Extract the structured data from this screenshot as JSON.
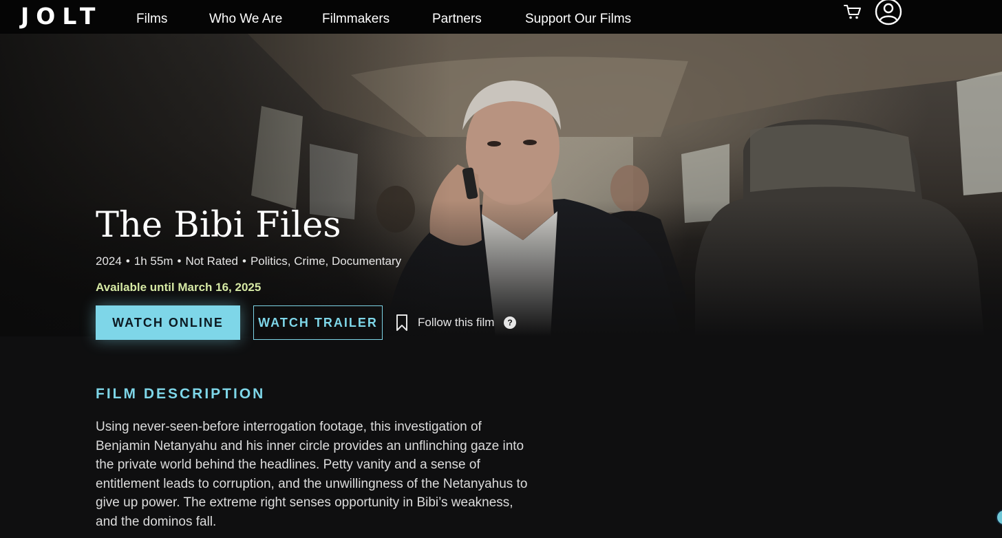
{
  "brand": {
    "logo": "JOLT"
  },
  "nav": {
    "links": [
      "Films",
      "Who We Are",
      "Filmmakers",
      "Partners",
      "Support Our Films"
    ],
    "cart_icon": "cart-icon",
    "account_icon": "user-icon"
  },
  "film": {
    "title": "The Bibi Files",
    "year": "2024",
    "runtime": "1h 55m",
    "rating": "Not Rated",
    "genres": "Politics, Crime, Documentary",
    "separator": "•",
    "availability": "Available until March 16, 2025"
  },
  "actions": {
    "watch_online": "WATCH ONLINE",
    "watch_trailer": "WATCH TRAILER",
    "follow": "Follow this film",
    "help": "?"
  },
  "description": {
    "heading": "FILM DESCRIPTION",
    "body": "Using never-seen-before interrogation footage, this investigation of Benjamin Netanyahu and his inner circle provides an unflinching gaze into the private world behind the headlines. Petty vanity and a sense of entitlement leads to corruption, and the unwillingness of the Netanyahus to give up power. The extreme right senses opportunity in Bibi’s weakness, and the dominos fall."
  },
  "colors": {
    "accent": "#7ed6e8",
    "availability": "#d6e9a4",
    "background": "#0f0f10",
    "nav": "#050505"
  }
}
